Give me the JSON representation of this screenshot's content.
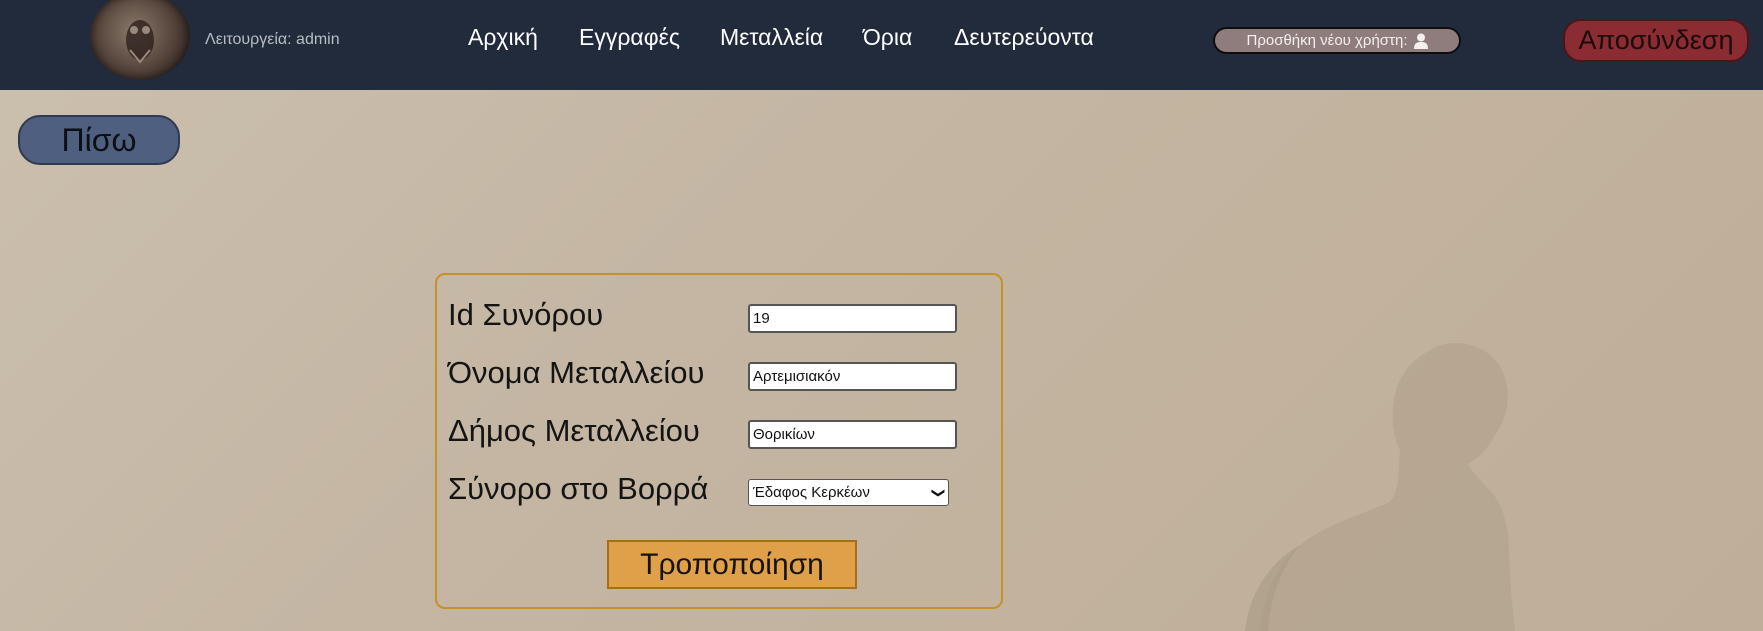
{
  "header": {
    "mode_label": "Λειτουργεία: admin",
    "nav": [
      {
        "label": "Αρχική"
      },
      {
        "label": "Εγγραφές"
      },
      {
        "label": "Μεταλλεία"
      },
      {
        "label": "Όρια"
      },
      {
        "label": "Δευτερεύοντα"
      }
    ],
    "add_user_label": "Προσθήκη νέου χρήστη:",
    "add_user_icon": "user-icon",
    "logout_label": "Αποσύνδεση"
  },
  "back_label": "Πίσω",
  "form": {
    "fields": [
      {
        "label": "Id Συνόρου",
        "value": "19"
      },
      {
        "label": "Όνομα Μεταλλείου",
        "value": "Αρτεμισιακόν"
      },
      {
        "label": "Δήμος Μεταλλείου",
        "value": "Θορικίων"
      },
      {
        "label": "Σύνορο στο Βορρά",
        "selected": "Έδαφος Κερκέων"
      }
    ],
    "submit_label": "Τροποποίηση"
  },
  "colors": {
    "topbar": "#222b3b",
    "back_button": "#4f5f7f",
    "logout_button": "#8a2c31",
    "submit_button": "#e0a04a",
    "panel_border": "#c98f2a"
  }
}
